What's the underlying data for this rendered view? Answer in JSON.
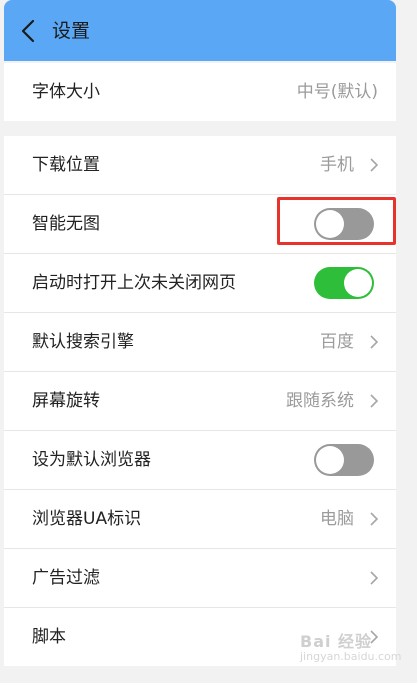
{
  "header": {
    "title": "设置",
    "back_icon": "chevron-left-icon"
  },
  "group1": [
    {
      "label": "字体大小",
      "value": "中号(默认)"
    }
  ],
  "group2": [
    {
      "label": "下载位置",
      "value": "手机",
      "type": "link"
    },
    {
      "label": "智能无图",
      "type": "toggle",
      "state": "off"
    },
    {
      "label": "启动时打开上次未关闭网页",
      "type": "toggle",
      "state": "on"
    },
    {
      "label": "默认搜索引擎",
      "value": "百度",
      "type": "link"
    },
    {
      "label": "屏幕旋转",
      "value": "跟随系统",
      "type": "link"
    },
    {
      "label": "设为默认浏览器",
      "type": "toggle",
      "state": "off"
    },
    {
      "label": "浏览器UA标识",
      "value": "电脑",
      "type": "link"
    },
    {
      "label": "广告过滤",
      "value": "",
      "type": "link"
    },
    {
      "label": "脚本",
      "value": "",
      "type": "link"
    }
  ],
  "watermark": {
    "text": "Bai 经验",
    "sub": "jingyan.baidu.com"
  },
  "colors": {
    "header": "#5aa8f5",
    "toggle_on": "#2fbe3a",
    "toggle_off": "#999999",
    "highlight": "#e8322c"
  }
}
